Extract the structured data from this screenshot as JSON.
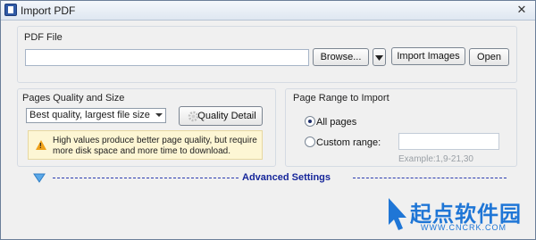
{
  "window": {
    "title": "Import PDF",
    "close_glyph": "✕"
  },
  "pdf_file": {
    "group_title": "PDF File",
    "path_value": "",
    "browse_label": "Browse...",
    "dropdown_icon": "triangle-down",
    "import_images_label": "Import Images",
    "open_label": "Open"
  },
  "quality": {
    "group_title": "Pages Quality and Size",
    "selected_option": "Best quality, largest file size",
    "detail_label": "Quality Detail",
    "warning_text": "High values produce better page quality, but require more disk space and more time to download."
  },
  "range": {
    "group_title": "Page Range to Import",
    "all_pages_label": "All pages",
    "custom_range_label": "Custom range:",
    "custom_range_value": "",
    "example_text": "Example:1,9-21,30"
  },
  "advanced": {
    "label": "Advanced Settings"
  },
  "watermark": {
    "text": "起点软件园",
    "url": "WWW.CNCRK.COM"
  },
  "colors": {
    "accent": "#16269a",
    "warning_bg": "#fdf6d4",
    "watermark": "#1f76d6"
  }
}
